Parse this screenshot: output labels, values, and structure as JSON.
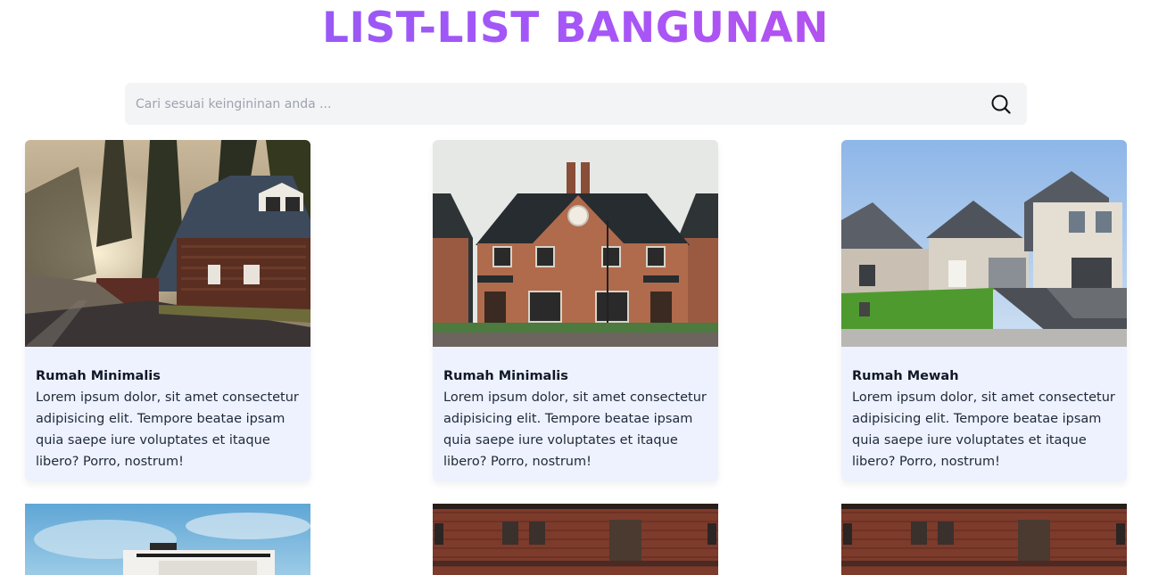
{
  "page": {
    "title": "LIST-LIST BANGUNAN"
  },
  "search": {
    "placeholder": "Cari sesuai keingininan anda ...",
    "value": "",
    "icon": "search-icon"
  },
  "cards": [
    {
      "name": "Rumah Minimalis",
      "description": "Lorem ipsum dolor, sit amet consectetur adipisicing elit. Tempore beatae ipsam quia saepe iure voluptates et itaque libero? Porro, nostrum!",
      "image": "brown-wooden-house-photo"
    },
    {
      "name": "Rumah Minimalis",
      "description": "Lorem ipsum dolor, sit amet consectetur adipisicing elit. Tempore beatae ipsam quia saepe iure voluptates et itaque libero? Porro, nostrum!",
      "image": "brick-house-photo"
    },
    {
      "name": "Rumah Mewah",
      "description": "Lorem ipsum dolor, sit amet consectetur adipisicing elit. Tempore beatae ipsam quia saepe iure voluptates et itaque libero? Porro, nostrum!",
      "image": "suburban-houses-photo"
    }
  ],
  "cards_row2": [
    {
      "image": "modern-building-photo"
    },
    {
      "image": "brick-wall-photo"
    },
    {
      "image": "brick-wall-photo"
    }
  ],
  "colors": {
    "title_gradient_start": "#8b5cf6",
    "title_gradient_end": "#c44ee0",
    "card_bg": "#eef2ff",
    "search_bg": "#f3f4f6"
  }
}
